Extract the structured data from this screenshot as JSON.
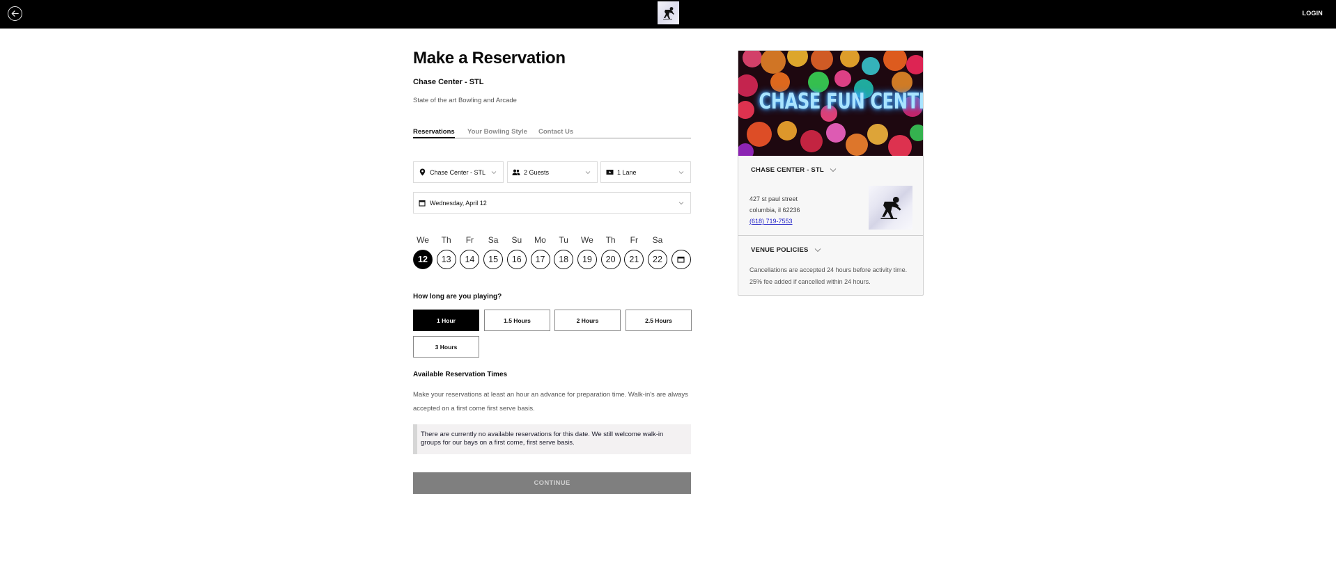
{
  "header": {
    "back_icon": "arrow-left-circle-icon",
    "logo_icon": "bowler-logo-icon",
    "login_label": "LOGIN"
  },
  "page": {
    "title": "Make a Reservation",
    "venue_name": "Chase Center - STL",
    "description": "State of the art Bowling and Arcade"
  },
  "tabs": [
    {
      "label": "Reservations",
      "active": true
    },
    {
      "label": "Your Bowling Style",
      "active": false
    },
    {
      "label": "Contact Us",
      "active": false
    }
  ],
  "selects": {
    "location": {
      "icon": "map-pin-icon",
      "value": "Chase Center - STL"
    },
    "guests": {
      "icon": "people-icon",
      "value": "2 Guests"
    },
    "lanes": {
      "icon": "ticket-icon",
      "value": "1 Lane"
    },
    "date": {
      "icon": "calendar-icon",
      "value": "Wednesday, April 12"
    }
  },
  "calendar": {
    "days": [
      {
        "weekday": "We",
        "date": "12",
        "selected": true
      },
      {
        "weekday": "Th",
        "date": "13",
        "selected": false
      },
      {
        "weekday": "Fr",
        "date": "14",
        "selected": false
      },
      {
        "weekday": "Sa",
        "date": "15",
        "selected": false
      },
      {
        "weekday": "Su",
        "date": "16",
        "selected": false
      },
      {
        "weekday": "Mo",
        "date": "17",
        "selected": false
      },
      {
        "weekday": "Tu",
        "date": "18",
        "selected": false
      },
      {
        "weekday": "We",
        "date": "19",
        "selected": false
      },
      {
        "weekday": "Th",
        "date": "20",
        "selected": false
      },
      {
        "weekday": "Fr",
        "date": "21",
        "selected": false
      },
      {
        "weekday": "Sa",
        "date": "22",
        "selected": false
      }
    ],
    "more_dates_icon": "calendar-icon"
  },
  "duration": {
    "question": "How long are you playing?",
    "options": [
      {
        "label": "1 Hour",
        "selected": true
      },
      {
        "label": "1.5 Hours",
        "selected": false
      },
      {
        "label": "2 Hours",
        "selected": false
      },
      {
        "label": "2.5 Hours",
        "selected": false
      },
      {
        "label": "3 Hours",
        "selected": false
      }
    ]
  },
  "availability": {
    "heading": "Available Reservation Times",
    "info": "Make your reservations at least an hour an advance for preparation time. Walk-in's are always accepted on a first come first serve basis.",
    "notice": "There are currently no available reservations for this date. We still welcome walk-in groups for our bays on a first come, first serve basis."
  },
  "continue_label": "CONTINUE",
  "venue_card": {
    "hero_text": "CHASE FUN CENTER",
    "venue_heading": "CHASE CENTER - STL",
    "address_line1": "427 st paul street",
    "address_line2": "columbia, il 62236",
    "phone": "(618) 719-7553",
    "policies_heading": "VENUE POLICIES",
    "policies_text": "Cancellations are accepted 24 hours before activity time. 25% fee added if cancelled within 24 hours."
  },
  "colors": {
    "header_bg": "#000000",
    "selected_bg": "#000000",
    "continue_disabled_bg": "#7f7f7f",
    "notice_bg": "#f3f1f2",
    "link": "#2424c8"
  }
}
